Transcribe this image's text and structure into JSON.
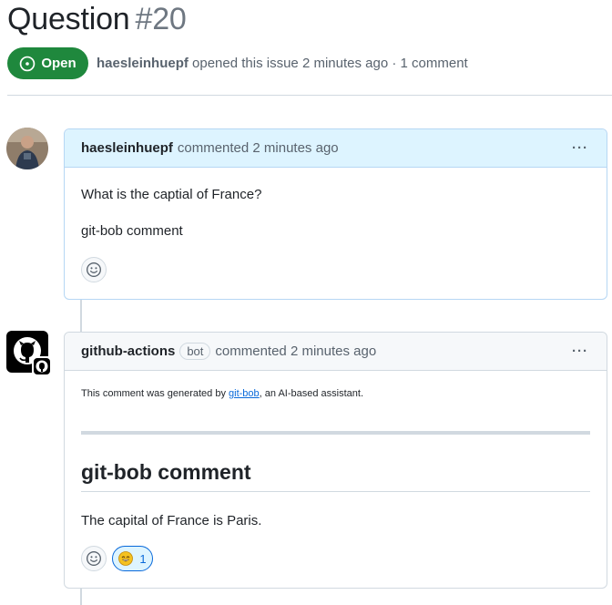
{
  "issue": {
    "title": "Question",
    "number": "#20",
    "state": "Open",
    "author": "haesleinhuepf",
    "meta_text": "opened this issue 2 minutes ago · 1 comment"
  },
  "comments": [
    {
      "author": "haesleinhuepf",
      "time_text": "commented 2 minutes ago",
      "menu": "···",
      "body": [
        "What is the captial of France?",
        "git-bob comment"
      ]
    },
    {
      "author": "github-actions",
      "badge": "bot",
      "time_text": "commented 2 minutes ago",
      "menu": "···",
      "note_prefix": "This comment was generated by ",
      "note_link": "git-bob",
      "note_suffix": ", an AI-based assistant.",
      "heading": "git-bob comment",
      "body": "The capital of France is Paris.",
      "reaction": {
        "emoji": "smile",
        "count": "1"
      }
    }
  ],
  "colors": {
    "open_green": "#1f883d",
    "link_blue": "#0969da",
    "highlight_header": "#ddf4ff"
  },
  "icons": [
    "issue-opened-icon",
    "kebab-horizontal-icon",
    "smiley-icon",
    "github-logo-icon"
  ]
}
